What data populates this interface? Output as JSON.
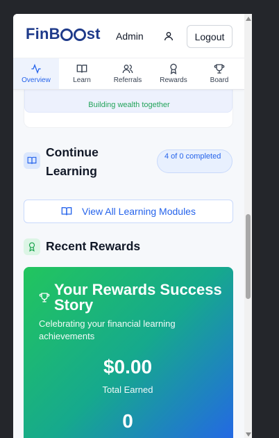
{
  "header": {
    "logo": [
      "FinB",
      "st"
    ],
    "user_name": "Admin",
    "logout_label": "Logout"
  },
  "tabs": [
    {
      "label": "Overview",
      "icon": "activity-icon",
      "active": true
    },
    {
      "label": "Learn",
      "icon": "book-icon",
      "active": false
    },
    {
      "label": "Referrals",
      "icon": "users-icon",
      "active": false
    },
    {
      "label": "Rewards",
      "icon": "award-icon",
      "active": false
    },
    {
      "label": "Board",
      "icon": "trophy-icon",
      "active": false
    }
  ],
  "previous_card": {
    "text": "Building wealth together"
  },
  "continue_learning": {
    "title": "Continue Learning",
    "badge": "4 of 0 completed",
    "view_all_label": "View All Learning Modules"
  },
  "recent_rewards": {
    "title": "Recent Rewards",
    "card_title": "Your Rewards Success Story",
    "card_subtitle": "Celebrating your financial learning achievements",
    "total_amount": "$0.00",
    "total_label": "Total Earned",
    "count": "0"
  },
  "colors": {
    "brand": "#1e3a8a",
    "accent": "#2563eb",
    "success": "#22c55e"
  }
}
